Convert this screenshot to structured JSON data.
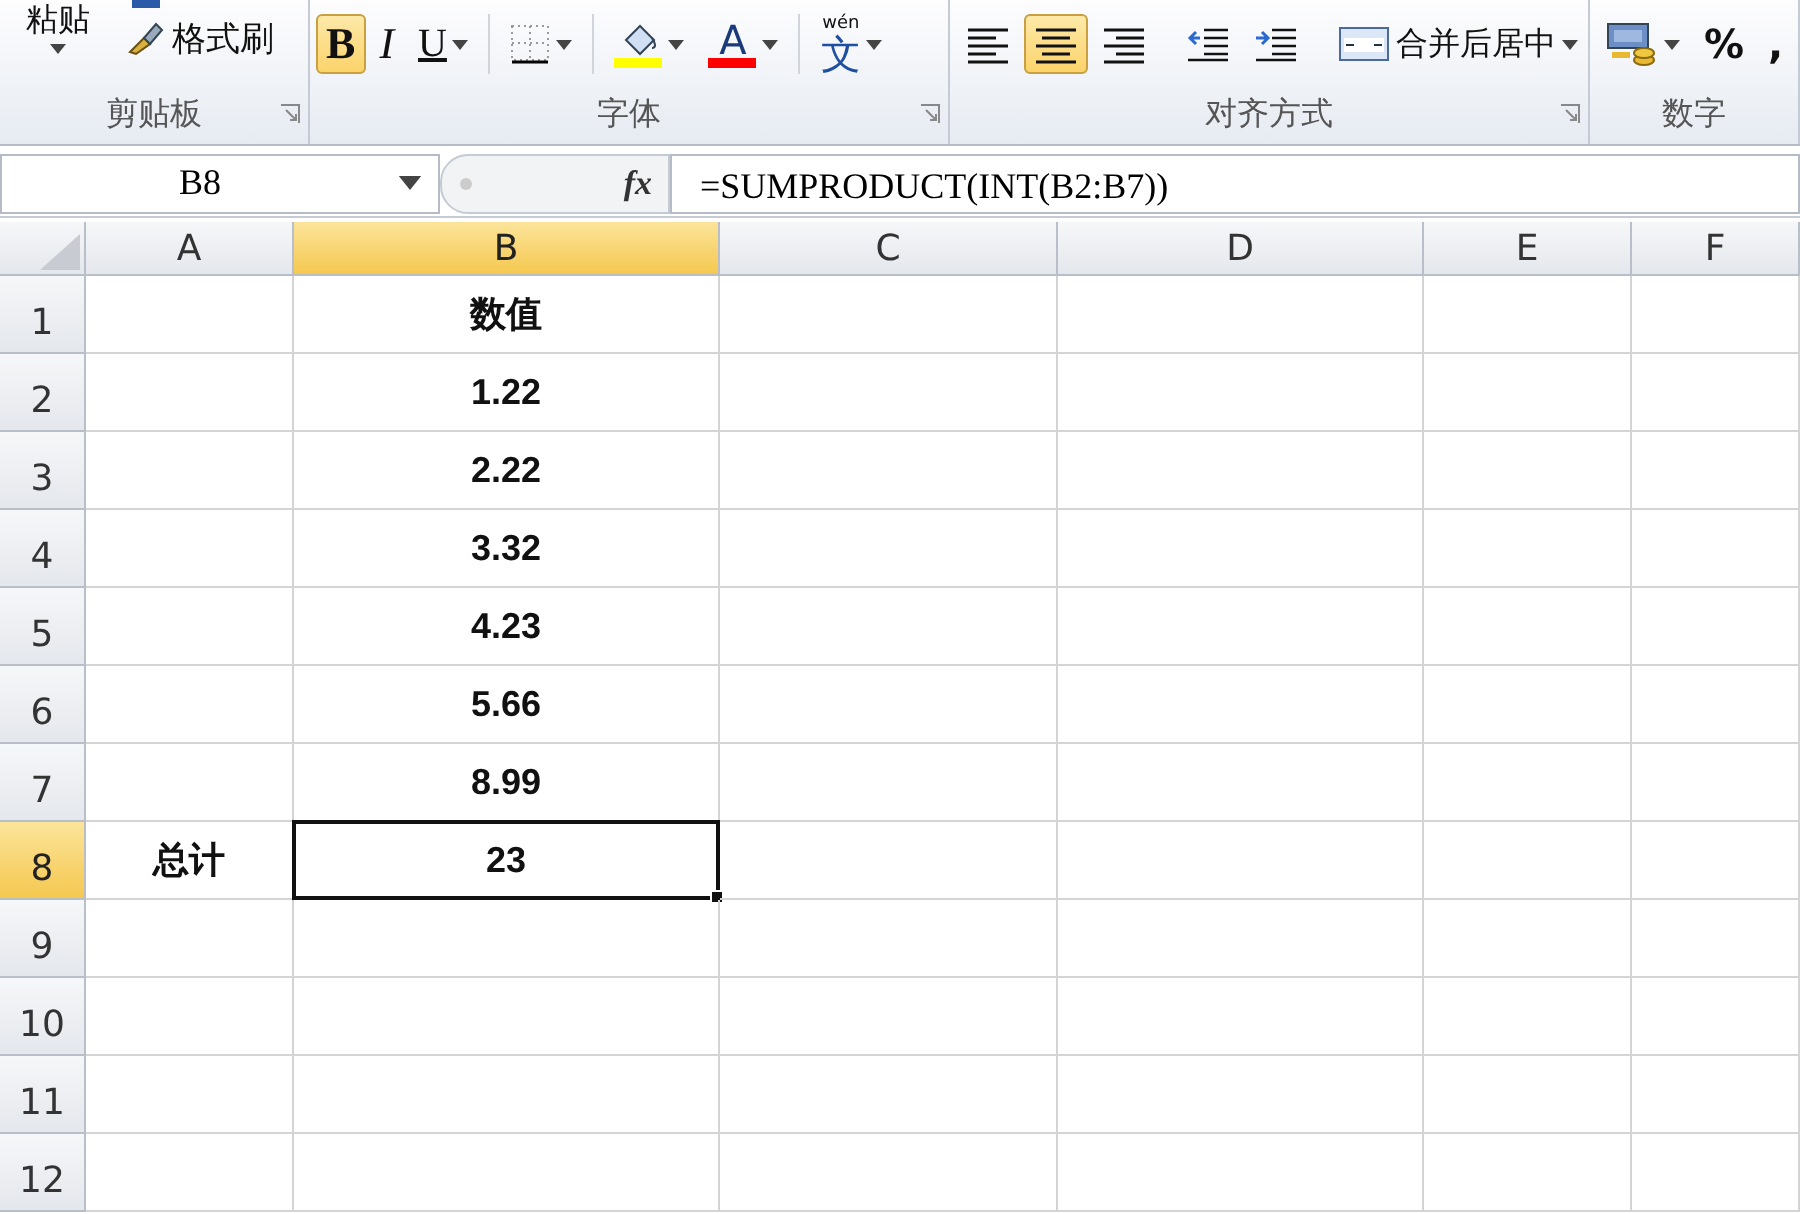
{
  "ribbon": {
    "groups": [
      {
        "kind": "clipboard",
        "label": "剪贴板",
        "launcher": true,
        "paste": "粘贴",
        "format_painter": "格式刷"
      },
      {
        "kind": "font",
        "label": "字体",
        "launcher": true,
        "tools": [
          {
            "kind": "bold",
            "label": "B",
            "selected": true,
            "dropdown": false
          },
          {
            "kind": "italic",
            "label": "I",
            "selected": false,
            "dropdown": false
          },
          {
            "kind": "underline",
            "label": "U",
            "selected": false,
            "dropdown": true
          },
          {
            "kind": "border",
            "selected": false,
            "dropdown": true
          },
          {
            "kind": "fill",
            "selected": false,
            "dropdown": true,
            "color": "#ffff00"
          },
          {
            "kind": "fontcolor",
            "label": "A",
            "selected": false,
            "dropdown": true,
            "color": "#ff0000"
          },
          {
            "kind": "phonetic",
            "label": "wén",
            "glyph": "文",
            "selected": false,
            "dropdown": true
          }
        ]
      },
      {
        "kind": "alignment",
        "label": "对齐方式",
        "launcher": true,
        "tools": [
          {
            "kind": "align-left",
            "selected": false,
            "dropdown": false
          },
          {
            "kind": "align-center",
            "selected": true,
            "dropdown": false
          },
          {
            "kind": "align-right",
            "selected": false,
            "dropdown": false
          },
          {
            "kind": "indent-decrease",
            "selected": false,
            "dropdown": false
          },
          {
            "kind": "indent-increase",
            "selected": false,
            "dropdown": false
          },
          {
            "kind": "merge",
            "label": "合并后居中",
            "selected": false,
            "dropdown": true
          }
        ]
      },
      {
        "kind": "number",
        "label": "数字",
        "launcher": false,
        "tools": [
          {
            "kind": "currency",
            "selected": false,
            "dropdown": true
          },
          {
            "kind": "text",
            "label": "%",
            "selected": false,
            "dropdown": false
          },
          {
            "kind": "text",
            "label": ",",
            "selected": false,
            "dropdown": false
          }
        ]
      }
    ]
  },
  "formula_bar": {
    "name_box": "B8",
    "fx": "fx",
    "formula": "=SUMPRODUCT(INT(B2:B7))"
  },
  "sheet": {
    "columns": [
      {
        "label": "A",
        "selected": false
      },
      {
        "label": "B",
        "selected": true
      },
      {
        "label": "C",
        "selected": false
      },
      {
        "label": "D",
        "selected": false
      },
      {
        "label": "E",
        "selected": false
      },
      {
        "label": "F",
        "selected": false
      }
    ],
    "rows": [
      {
        "label": "1",
        "selected": false,
        "cells": [
          "",
          "数值",
          "",
          "",
          "",
          ""
        ]
      },
      {
        "label": "2",
        "selected": false,
        "cells": [
          "",
          "1.22",
          "",
          "",
          "",
          ""
        ]
      },
      {
        "label": "3",
        "selected": false,
        "cells": [
          "",
          "2.22",
          "",
          "",
          "",
          ""
        ]
      },
      {
        "label": "4",
        "selected": false,
        "cells": [
          "",
          "3.32",
          "",
          "",
          "",
          ""
        ]
      },
      {
        "label": "5",
        "selected": false,
        "cells": [
          "",
          "4.23",
          "",
          "",
          "",
          ""
        ]
      },
      {
        "label": "6",
        "selected": false,
        "cells": [
          "",
          "5.66",
          "",
          "",
          "",
          ""
        ]
      },
      {
        "label": "7",
        "selected": false,
        "cells": [
          "",
          "8.99",
          "",
          "",
          "",
          ""
        ]
      },
      {
        "label": "8",
        "selected": true,
        "cells": [
          "总计",
          "23",
          "",
          "",
          "",
          ""
        ]
      },
      {
        "label": "9",
        "selected": false,
        "cells": [
          "",
          "",
          "",
          "",
          "",
          ""
        ]
      },
      {
        "label": "10",
        "selected": false,
        "cells": [
          "",
          "",
          "",
          "",
          "",
          ""
        ]
      },
      {
        "label": "11",
        "selected": false,
        "cells": [
          "",
          "",
          "",
          "",
          "",
          ""
        ]
      },
      {
        "label": "12",
        "selected": false,
        "cells": [
          "",
          "",
          "",
          "",
          "",
          ""
        ]
      }
    ]
  }
}
